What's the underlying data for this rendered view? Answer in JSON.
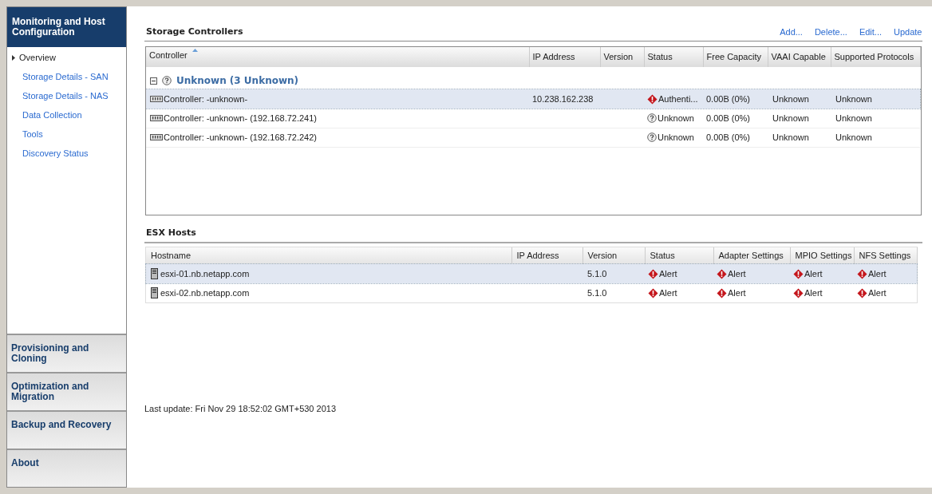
{
  "sidebar": {
    "header": "Monitoring and Host Configuration",
    "items": [
      {
        "label": "Overview",
        "selected": true
      },
      {
        "label": "Storage Details - SAN",
        "selected": false
      },
      {
        "label": "Storage Details - NAS",
        "selected": false
      },
      {
        "label": "Data Collection",
        "selected": false
      },
      {
        "label": "Tools",
        "selected": false
      },
      {
        "label": "Discovery Status",
        "selected": false
      }
    ],
    "sections": [
      "Provisioning and Cloning",
      "Optimization and Migration",
      "Backup and Recovery",
      "About"
    ]
  },
  "storage_controllers": {
    "title": "Storage Controllers",
    "actions": [
      "Add...",
      "Delete...",
      "Edit...",
      "Update"
    ],
    "columns": [
      {
        "label": "Controller",
        "sorted": true
      },
      {
        "label": "IP Address",
        "sorted": false
      },
      {
        "label": "Version",
        "sorted": false
      },
      {
        "label": "Status",
        "sorted": false
      },
      {
        "label": "Free Capacity",
        "sorted": false
      },
      {
        "label": "VAAI Capable",
        "sorted": false
      },
      {
        "label": "Supported Protocols",
        "sorted": false
      }
    ],
    "group": {
      "label": "Unknown (3 Unknown)",
      "expanded": true
    },
    "rows": [
      {
        "selected": true,
        "controller": "Controller: -unknown-",
        "ip": "10.238.162.238",
        "version": "",
        "status": {
          "kind": "alert",
          "text": "Authenti..."
        },
        "free_capacity": "0.00B (0%)",
        "vaai": "Unknown",
        "protocols": "Unknown"
      },
      {
        "selected": false,
        "controller": "Controller: -unknown- (192.168.72.241)",
        "ip": "",
        "version": "",
        "status": {
          "kind": "unknown",
          "text": "Unknown"
        },
        "free_capacity": "0.00B (0%)",
        "vaai": "Unknown",
        "protocols": "Unknown"
      },
      {
        "selected": false,
        "controller": "Controller: -unknown- (192.168.72.242)",
        "ip": "",
        "version": "",
        "status": {
          "kind": "unknown",
          "text": "Unknown"
        },
        "free_capacity": "0.00B (0%)",
        "vaai": "Unknown",
        "protocols": "Unknown"
      }
    ]
  },
  "esx_hosts": {
    "title": "ESX Hosts",
    "columns": [
      "Hostname",
      "IP Address",
      "Version",
      "Status",
      "Adapter Settings",
      "MPIO Settings",
      "NFS Settings"
    ],
    "rows": [
      {
        "selected": true,
        "hostname": "esxi-01.nb.netapp.com",
        "ip": "",
        "version": "5.1.0",
        "status": {
          "kind": "alert",
          "text": "Alert"
        },
        "adapter": {
          "kind": "alert",
          "text": "Alert"
        },
        "mpio": {
          "kind": "alert",
          "text": "Alert"
        },
        "nfs": {
          "kind": "alert",
          "text": "Alert"
        }
      },
      {
        "selected": false,
        "hostname": "esxi-02.nb.netapp.com",
        "ip": "",
        "version": "5.1.0",
        "status": {
          "kind": "alert",
          "text": "Alert"
        },
        "adapter": {
          "kind": "alert",
          "text": "Alert"
        },
        "mpio": {
          "kind": "alert",
          "text": "Alert"
        },
        "nfs": {
          "kind": "alert",
          "text": "Alert"
        }
      }
    ]
  },
  "status_bar": {
    "last_update": "Last update: Fri Nov 29 18:52:02 GMT+530 2013"
  }
}
